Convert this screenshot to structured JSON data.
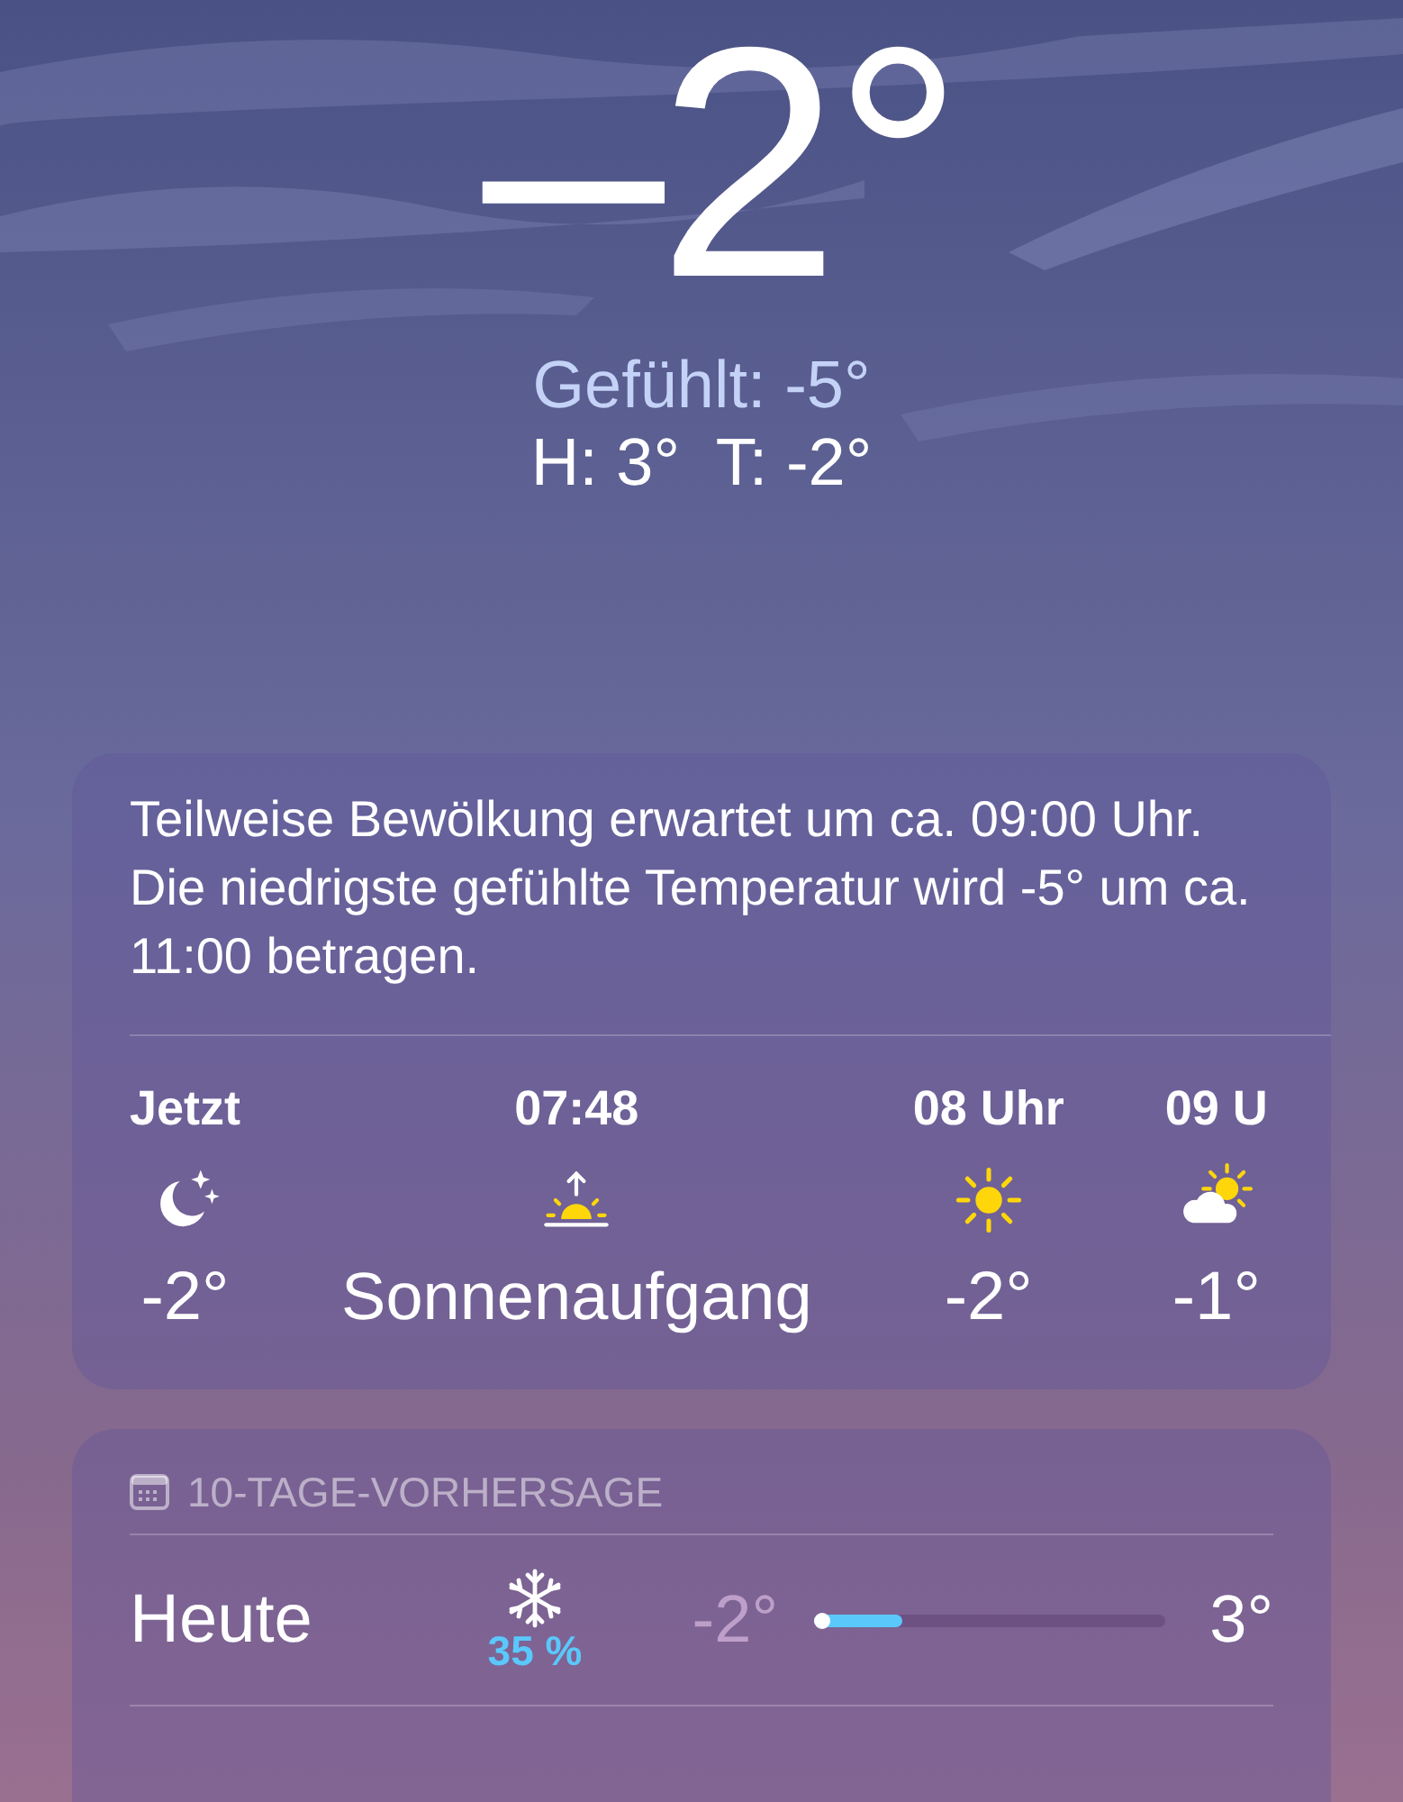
{
  "current": {
    "temperature": "–2°",
    "feels_like": "Gefühlt: -5°",
    "high_low": "H: 3°  T: -2°"
  },
  "hourly": {
    "summary": "Teilweise Bewölkung erwartet um ca. 09:00 Uhr. Die niedrigste gefühlte Temperatur wird -5° um ca. 11:00 betragen.",
    "items": [
      {
        "kind": "hour",
        "label": "Jetzt",
        "value": "-2°"
      },
      {
        "kind": "event",
        "label": "07:48",
        "value": "Sonnenaufgang"
      },
      {
        "kind": "hour",
        "label": "08 Uhr",
        "value": "-2°"
      },
      {
        "kind": "hour",
        "label": "09 U",
        "value": "-1°"
      }
    ]
  },
  "daily": {
    "title": "10-TAGE-VORHERSAGE",
    "days": [
      {
        "day": "Heute",
        "precipitation": "35 %",
        "low": "-2°",
        "high": "3°",
        "level": 0.25
      }
    ]
  }
}
